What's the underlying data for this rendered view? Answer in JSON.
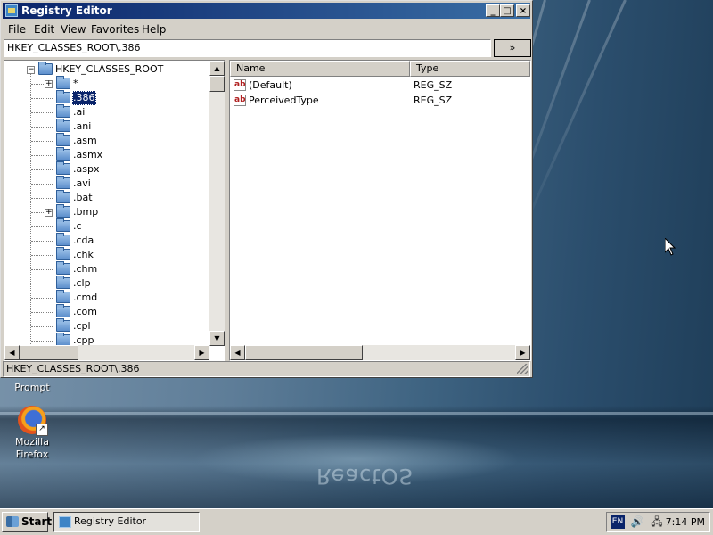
{
  "window": {
    "title": "Registry Editor",
    "controls": {
      "minimize": "_",
      "maximize": "□",
      "close": "×"
    }
  },
  "menu": {
    "file": "File",
    "edit": "Edit",
    "view": "View",
    "favorites": "Favorites",
    "help": "Help"
  },
  "address": {
    "value": "HKEY_CLASSES_ROOT\\.386",
    "go_label": "»"
  },
  "tree": {
    "root": "HKEY_CLASSES_ROOT",
    "items": [
      {
        "label": "*",
        "expandable": true
      },
      {
        "label": ".386",
        "selected": true
      },
      {
        "label": ".ai"
      },
      {
        "label": ".ani"
      },
      {
        "label": ".asm"
      },
      {
        "label": ".asmx"
      },
      {
        "label": ".aspx"
      },
      {
        "label": ".avi"
      },
      {
        "label": ".bat"
      },
      {
        "label": ".bmp",
        "expandable": true
      },
      {
        "label": ".c"
      },
      {
        "label": ".cda"
      },
      {
        "label": ".chk"
      },
      {
        "label": ".chm"
      },
      {
        "label": ".clp"
      },
      {
        "label": ".cmd"
      },
      {
        "label": ".com"
      },
      {
        "label": ".cpl"
      },
      {
        "label": ".cpp"
      }
    ]
  },
  "list": {
    "columns": [
      "Name",
      "Type"
    ],
    "rows": [
      {
        "name": "(Default)",
        "type": "REG_SZ",
        "icon": "ab"
      },
      {
        "name": "PerceivedType",
        "type": "REG_SZ",
        "icon": "ab"
      }
    ]
  },
  "status": "HKEY_CLASSES_ROOT\\.386",
  "desktop": {
    "prompt_label": "Prompt",
    "firefox_label_1": "Mozilla",
    "firefox_label_2": "Firefox",
    "logo_text": "ReactOS"
  },
  "taskbar": {
    "start": "Start",
    "task": "Registry Editor",
    "lang": "EN",
    "time": "7:14 PM"
  },
  "colors": {
    "titlebar_start": "#0a246a",
    "titlebar_end": "#3a6ea5",
    "selection": "#0a246a",
    "chrome": "#d4d0c8"
  }
}
